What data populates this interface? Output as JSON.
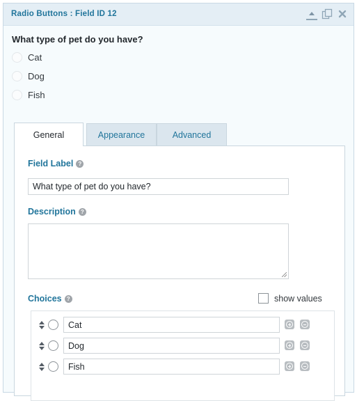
{
  "window": {
    "title": "Radio Buttons : Field ID 12",
    "icons": [
      "collapse-icon",
      "duplicate-icon",
      "delete-icon"
    ]
  },
  "preview": {
    "question": "What type of pet do you have?",
    "options": [
      "Cat",
      "Dog",
      "Fish"
    ]
  },
  "tabs": [
    {
      "label": "General",
      "active": true
    },
    {
      "label": "Appearance",
      "active": false
    },
    {
      "label": "Advanced",
      "active": false
    }
  ],
  "general": {
    "field_label": {
      "label": "Field Label",
      "value": "What type of pet do you have?"
    },
    "description": {
      "label": "Description",
      "value": ""
    },
    "choices": {
      "label": "Choices",
      "show_values_label": "show values",
      "show_values_checked": false,
      "items": [
        "Cat",
        "Dog",
        "Fish"
      ]
    }
  },
  "colors": {
    "accent": "#21759b",
    "titlebar": "#e4eef5"
  }
}
